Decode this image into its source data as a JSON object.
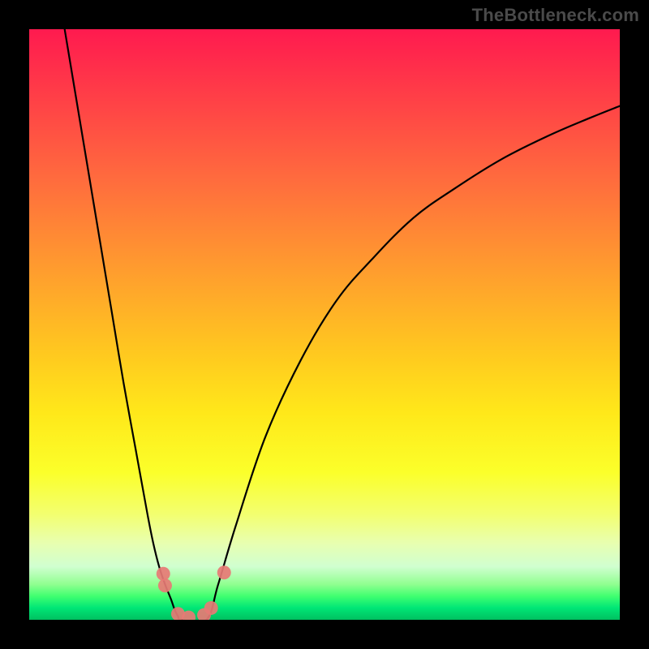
{
  "watermark": "TheBottleneck.com",
  "chart_data": {
    "type": "line",
    "title": "",
    "xlabel": "",
    "ylabel": "",
    "xlim": [
      0,
      1
    ],
    "ylim": [
      0,
      1
    ],
    "series": [
      {
        "name": "left-curve",
        "x": [
          0.06,
          0.08,
          0.1,
          0.12,
          0.14,
          0.16,
          0.18,
          0.2,
          0.21,
          0.22,
          0.23,
          0.24,
          0.246,
          0.252,
          0.258
        ],
        "y": [
          1.0,
          0.88,
          0.76,
          0.64,
          0.52,
          0.4,
          0.29,
          0.18,
          0.13,
          0.09,
          0.06,
          0.035,
          0.018,
          0.006,
          0.0
        ]
      },
      {
        "name": "floor",
        "x": [
          0.258,
          0.3
        ],
        "y": [
          0.0,
          0.0
        ]
      },
      {
        "name": "right-curve",
        "x": [
          0.3,
          0.32,
          0.35,
          0.4,
          0.46,
          0.52,
          0.58,
          0.65,
          0.72,
          0.8,
          0.88,
          0.95,
          1.0
        ],
        "y": [
          0.0,
          0.06,
          0.16,
          0.31,
          0.44,
          0.54,
          0.61,
          0.68,
          0.73,
          0.78,
          0.82,
          0.85,
          0.87
        ]
      }
    ],
    "markers": [
      {
        "x": 0.227,
        "y": 0.078
      },
      {
        "x": 0.23,
        "y": 0.058
      },
      {
        "x": 0.252,
        "y": 0.01
      },
      {
        "x": 0.27,
        "y": 0.004
      },
      {
        "x": 0.296,
        "y": 0.008
      },
      {
        "x": 0.308,
        "y": 0.02
      },
      {
        "x": 0.33,
        "y": 0.08
      }
    ],
    "marker_color": "#e77a75",
    "line_color": "#000000"
  }
}
